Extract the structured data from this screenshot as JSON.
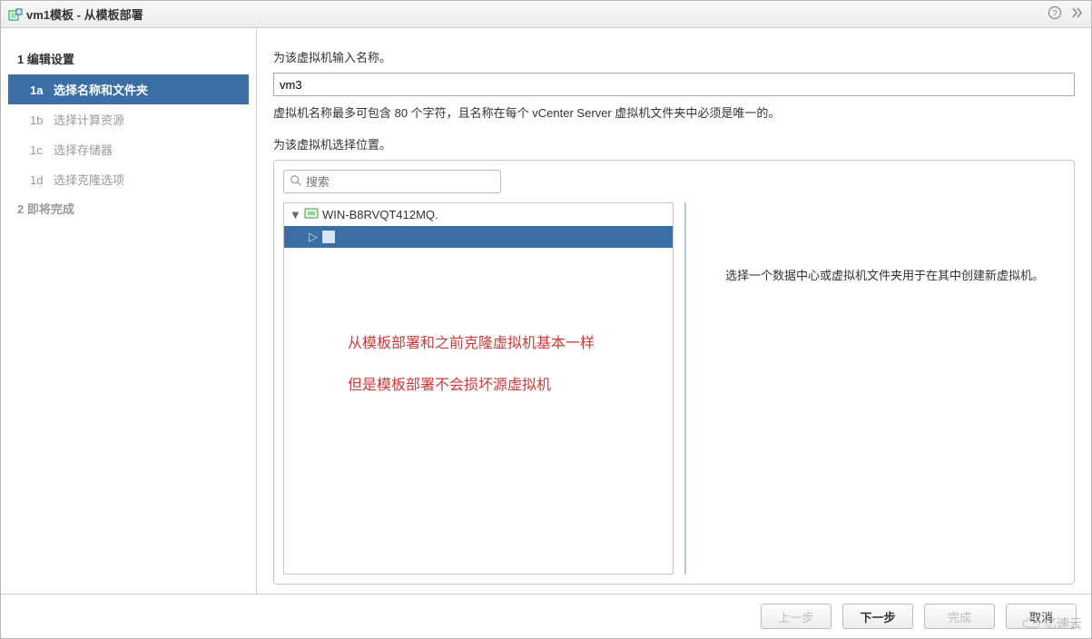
{
  "title": "vm1模板 - 从模板部署",
  "sidebar": {
    "step1": {
      "label": "1 编辑设置"
    },
    "substeps": [
      {
        "code": "1a",
        "label": "选择名称和文件夹",
        "active": true
      },
      {
        "code": "1b",
        "label": "选择计算资源",
        "active": false
      },
      {
        "code": "1c",
        "label": "选择存储器",
        "active": false
      },
      {
        "code": "1d",
        "label": "选择克隆选项",
        "active": false
      }
    ],
    "step2": {
      "label": "2 即将完成"
    }
  },
  "content": {
    "name_prompt": "为该虚拟机输入名称。",
    "name_value": "vm3",
    "name_hint": "虚拟机名称最多可包含 80 个字符，且名称在每个 vCenter Server 虚拟机文件夹中必须是唯一的。",
    "loc_prompt": "为该虚拟机选择位置。",
    "search_placeholder": "搜索",
    "tree": {
      "root": "WIN-B8RVQT412MQ.",
      "child": ""
    },
    "side_hint": "选择一个数据中心或虚拟机文件夹用于在其中创建新虚拟机。",
    "annotation1": "从模板部署和之前克隆虚拟机基本一样",
    "annotation2": "但是模板部署不会损坏源虚拟机"
  },
  "footer": {
    "back": "上一步",
    "next": "下一步",
    "finish": "完成",
    "cancel": "取消"
  },
  "watermark": "亿速云"
}
